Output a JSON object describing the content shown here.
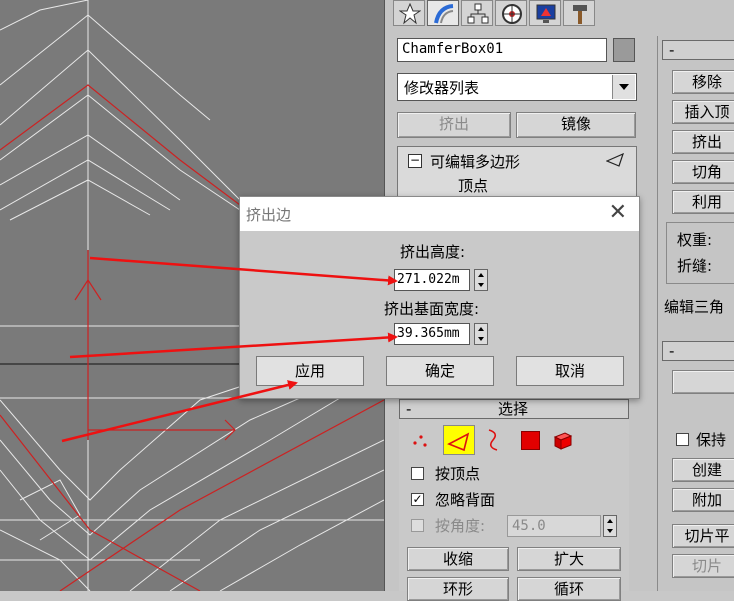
{
  "dialog": {
    "title": "挤出边",
    "height_label": "挤出高度:",
    "height_value": "271.022m",
    "width_label": "挤出基面宽度:",
    "width_value": "39.365mm",
    "apply_label": "应用",
    "ok_label": "确定",
    "cancel_label": "取消"
  },
  "command_panel": {
    "object_name": "ChamferBox01",
    "modifier_list": "修改器列表",
    "extrude_button": "挤出",
    "mirror_button": "镜像",
    "stack_item": "可编辑多边形",
    "stack_sub": "顶点"
  },
  "selection_rollout": {
    "header": "选择",
    "by_vertex": "按顶点",
    "ignore_backface": "忽略背面",
    "by_angle": "按角度:",
    "angle_value": "45.0",
    "shrink_button": "收缩",
    "grow_button": "扩大",
    "ring_button": "环形",
    "loop_button": "循环"
  },
  "right_column": {
    "remove": "移除",
    "insert_vertex": "插入顶",
    "extrude": "挤出",
    "chamfer": "切角",
    "use": "利用",
    "weight": "权重:",
    "crease": "折缝:",
    "edit_tri": "编辑三角",
    "keep": "保持",
    "create": "创建",
    "attach": "附加",
    "slice_plane": "切片平",
    "slice": "切片"
  },
  "colors": {
    "accent_arrow": "#ee1111",
    "viewport_bg": "#7a7a7a",
    "edge_highlight": "#cc2222",
    "active_tool": "#ffff00"
  }
}
